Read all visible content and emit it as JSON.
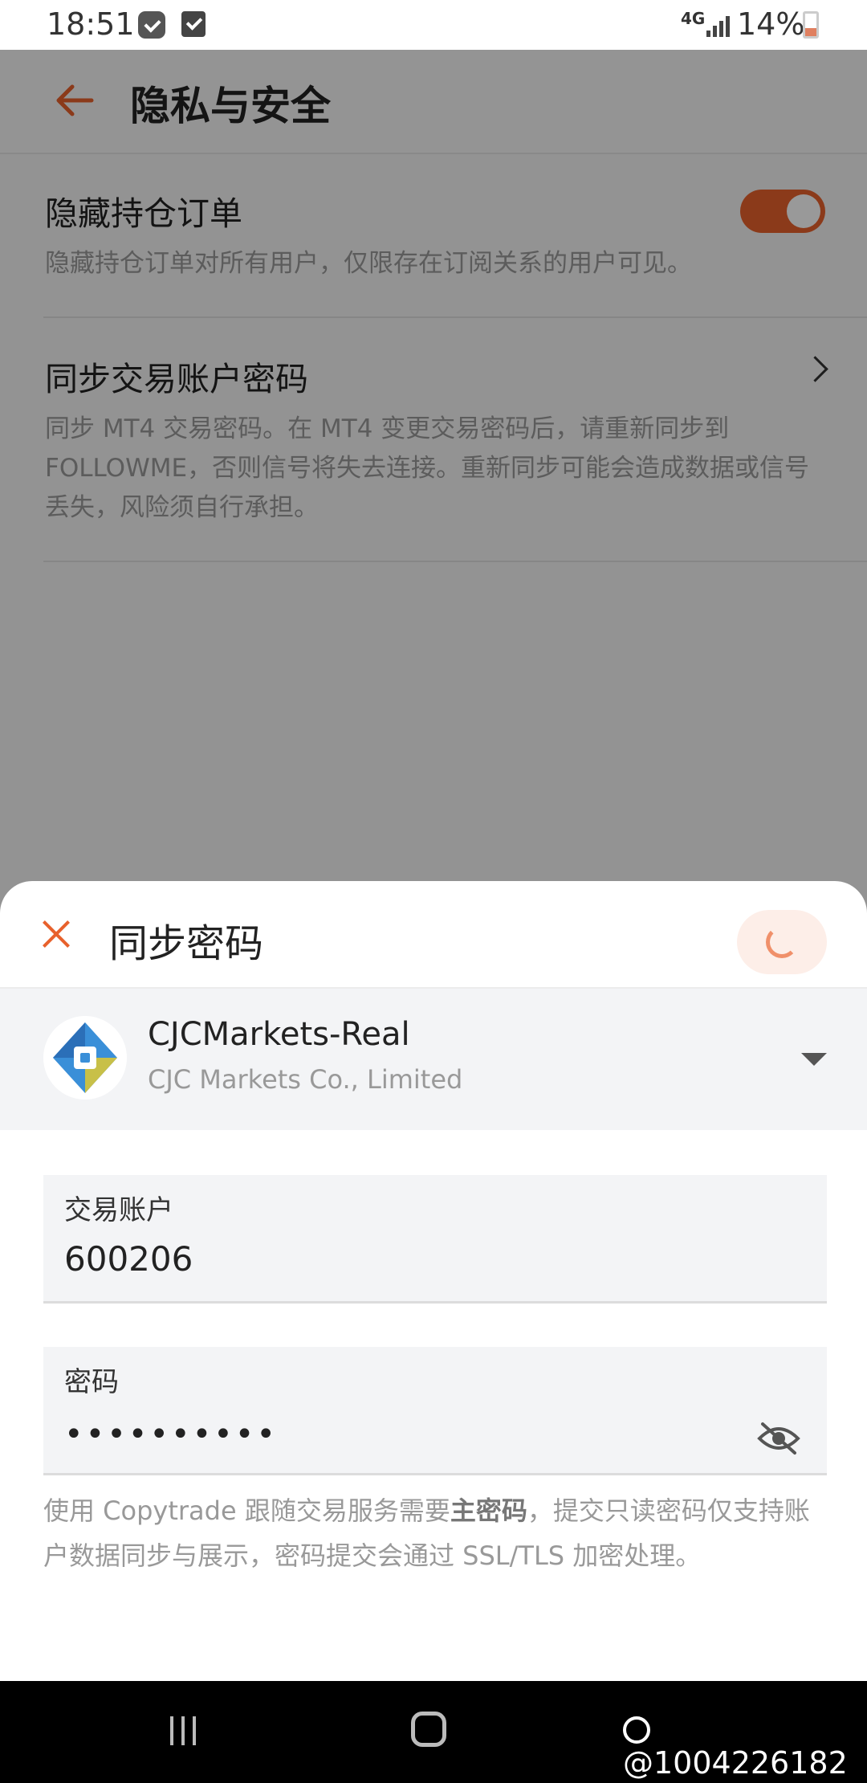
{
  "status_bar": {
    "time": "18:51",
    "network": "4G",
    "battery": "14%"
  },
  "app_bar": {
    "title": "隐私与安全"
  },
  "settings": [
    {
      "title": "隐藏持仓订单",
      "description": "隐藏持仓订单对所有用户，仅限存在订阅关系的用户可见。",
      "toggle_on": true
    },
    {
      "title": "同步交易账户密码",
      "description": "同步 MT4 交易密码。在 MT4 变更交易密码后，请重新同步到 FOLLOWME，否则信号将失去连接。重新同步可能会造成数据或信号丢失，风险须自行承担。"
    }
  ],
  "sheet": {
    "title": "同步密码",
    "server": {
      "name": "CJCMarkets-Real",
      "company": "CJC Markets Co., Limited"
    },
    "account_field": {
      "label": "交易账户",
      "value": "600206"
    },
    "password_field": {
      "label": "密码",
      "value": "••••••••••"
    },
    "note_before": "使用 Copytrade 跟随交易服务需要",
    "note_bold": "主密码",
    "note_after": "，提交只读密码仅支持账户数据同步与展示，密码提交会通过 SSL/TLS 加密处理。"
  },
  "nav_bar": {
    "watermark": "@1004226182"
  },
  "colors": {
    "accent": "#e8612c",
    "sheet_bg": "#ffffff",
    "field_bg": "#f3f4f6",
    "overlay": "rgba(0,0,0,0.40)"
  }
}
